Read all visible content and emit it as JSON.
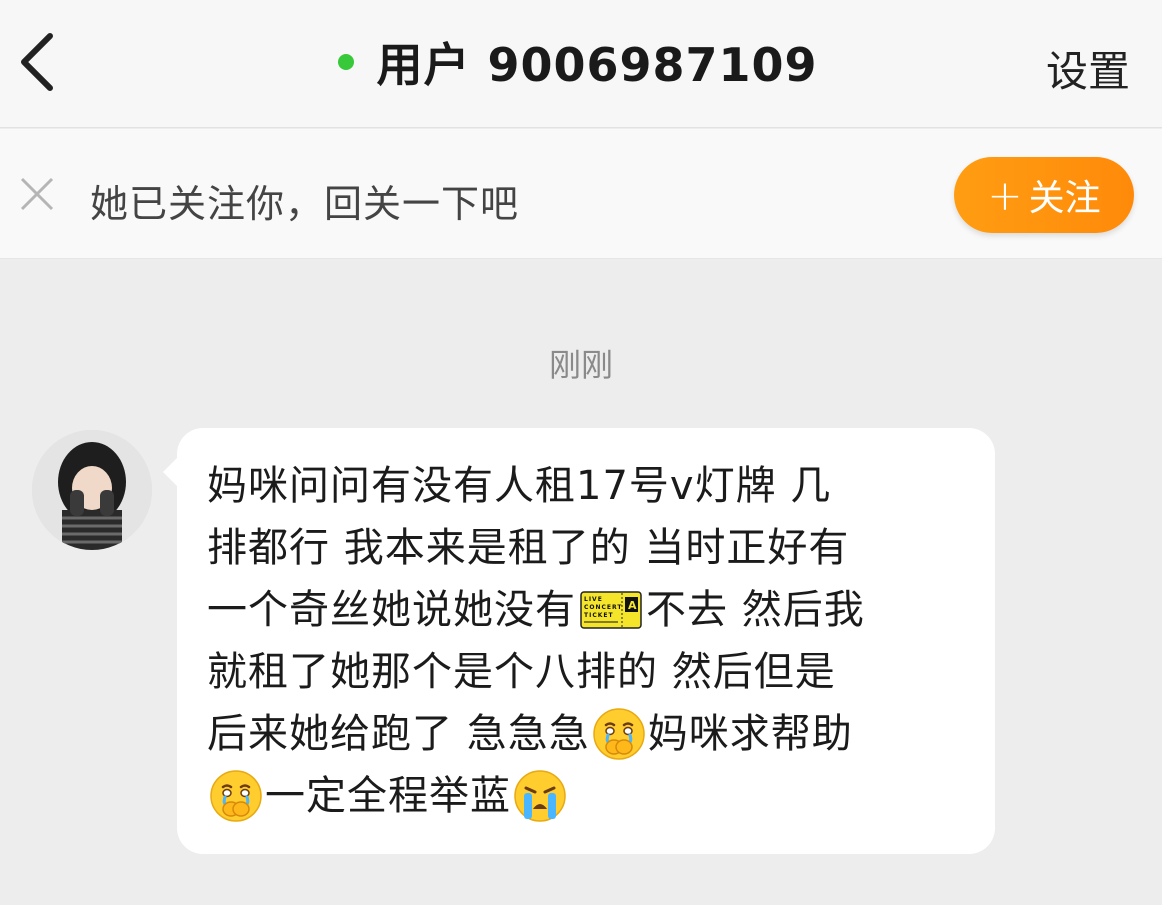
{
  "header": {
    "back_icon": "chevron-left-icon",
    "online_status_color": "#38c93b",
    "title": "用户 9006987109",
    "settings_label": "设置"
  },
  "follow_bar": {
    "close_icon": "close-icon",
    "text": "她已关注你，回关一下吧",
    "button_plus": "+",
    "button_label": "关注",
    "button_color": "#ff930e"
  },
  "chat": {
    "timestamp": "刚刚",
    "message": {
      "sender_avatar": "avatar",
      "lines": [
        "妈咪问问有没有人租17号v灯牌 几",
        "排都行 我本来是租了的 当时正好有",
        [
          "一个奇丝她说她没有",
          "不去 然后我"
        ],
        "就租了她那个是个八排的 然后但是",
        [
          "后来她给跑了 急急急",
          "妈咪求帮助"
        ],
        [
          "",
          "一定全程举蓝"
        ]
      ],
      "ticket_text_1": "LIVE",
      "ticket_text_2": "CONCERT",
      "ticket_text_3": "TICKET",
      "ticket_seat": "A"
    }
  }
}
